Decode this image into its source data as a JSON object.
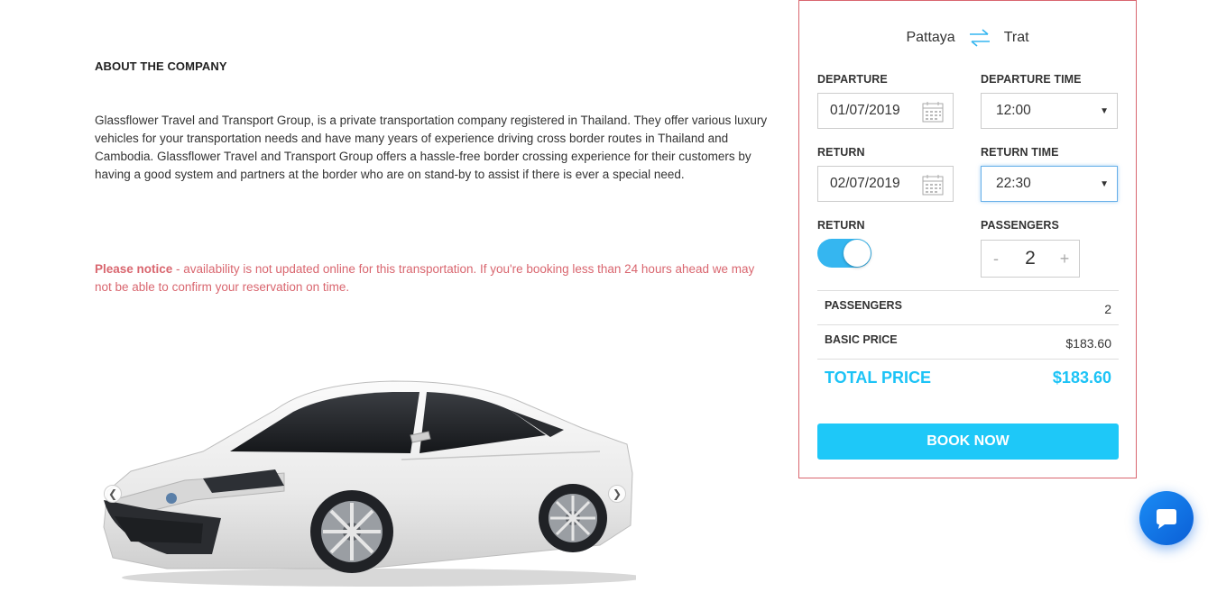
{
  "about": {
    "heading": "ABOUT THE COMPANY",
    "text": "Glassflower Travel and Transport Group, is a private transportation company registered in Thailand. They offer various luxury vehicles for your transportation needs and have many years of experience driving cross border routes in Thailand and Cambodia. Glassflower Travel and Transport Group offers a hassle-free border crossing experience for their customers by having a good system and partners at the border who are on stand-by to assist if there is ever a special need."
  },
  "notice": {
    "label": "Please notice",
    "text": " - availability is not updated online for this transportation. If you're booking less than 24 hours ahead we may not be able to confirm your reservation on time."
  },
  "booking": {
    "from": "Pattaya",
    "to": "Trat",
    "departure_label": "DEPARTURE",
    "departure_date": "01/07/2019",
    "departure_time_label": "DEPARTURE TIME",
    "departure_time": "12:00",
    "return_label": "RETURN",
    "return_date": "02/07/2019",
    "return_time_label": "RETURN TIME",
    "return_time": "22:30",
    "return_toggle_label": "RETURN",
    "return_toggle_on": true,
    "passengers_label": "PASSENGERS",
    "passengers_count": "2",
    "stepper_minus": "-",
    "stepper_plus": "+",
    "summary": {
      "passengers_key": "PASSENGERS",
      "passengers_value": "2",
      "basic_price_key": "BASIC PRICE",
      "basic_price_value": "$183.60",
      "total_key": "TOTAL PRICE",
      "total_value": "$183.60"
    },
    "book_button": "BOOK NOW"
  },
  "colors": {
    "accent": "#1ec8f8",
    "notice": "#d9666f",
    "chat": "#1a8cf5"
  }
}
